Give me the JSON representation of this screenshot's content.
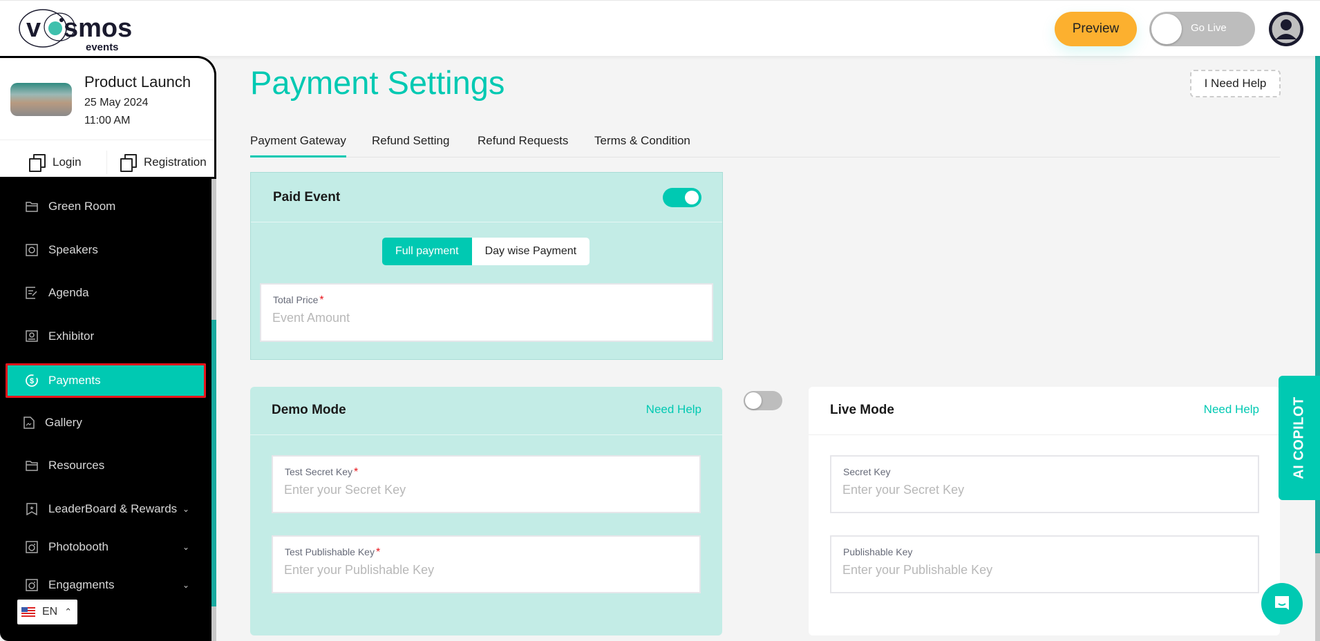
{
  "header": {
    "logo_text": "vosmos",
    "logo_sub": "events",
    "preview_label": "Preview",
    "golive_label": "Go Live",
    "golive_on": false
  },
  "event": {
    "title": "Product Launch",
    "date": "25 May 2024",
    "time": "11:00 AM",
    "login_label": "Login",
    "registration_label": "Registration"
  },
  "sidebar": {
    "items": [
      {
        "label": "Green Room",
        "icon": "folder-icon"
      },
      {
        "label": "Speakers",
        "icon": "speaker-icon"
      },
      {
        "label": "Agenda",
        "icon": "agenda-icon"
      },
      {
        "label": "Exhibitor",
        "icon": "exhibitor-icon"
      },
      {
        "label": "Payments",
        "icon": "payments-icon",
        "active": true
      },
      {
        "label": "Gallery",
        "icon": "gallery-icon"
      },
      {
        "label": "Resources",
        "icon": "folder-icon"
      },
      {
        "label": "LeaderBoard & Rewards",
        "icon": "bookmark-star-icon",
        "expandable": true
      },
      {
        "label": "Photobooth",
        "icon": "camera-icon",
        "expandable": true
      },
      {
        "label": "Engagments",
        "icon": "camera-icon",
        "expandable": true
      }
    ],
    "language": "EN"
  },
  "main": {
    "title": "Payment Settings",
    "need_help_label": "I Need Help",
    "tabs": [
      {
        "label": "Payment Gateway",
        "active": true
      },
      {
        "label": "Refund Setting"
      },
      {
        "label": "Refund Requests"
      },
      {
        "label": "Terms & Condition"
      }
    ],
    "paid_event": {
      "title": "Paid Event",
      "enabled": true,
      "payment_types": [
        {
          "label": "Full payment",
          "active": true
        },
        {
          "label": "Day wise Payment"
        }
      ],
      "total_price_label": "Total Price",
      "total_price_placeholder": "Event Amount",
      "total_price_value": ""
    },
    "demo_mode": {
      "title": "Demo Mode",
      "help_label": "Need Help",
      "secret_label": "Test Secret Key",
      "secret_placeholder": "Enter your Secret Key",
      "publishable_label": "Test Publishable Key",
      "publishable_placeholder": "Enter your Publishable Key"
    },
    "mode_toggle_live": false,
    "live_mode": {
      "title": "Live Mode",
      "help_label": "Need Help",
      "secret_label": "Secret Key",
      "secret_placeholder": "Enter your Secret Key",
      "publishable_label": "Publishable Key",
      "publishable_placeholder": "Enter your Publishable Key"
    }
  },
  "copilot_label": "AI COPILOT",
  "colors": {
    "accent": "#00c9b2",
    "preview": "#fcb02f",
    "highlight_border": "#e8141b",
    "card_tint": "#c3ece6"
  }
}
